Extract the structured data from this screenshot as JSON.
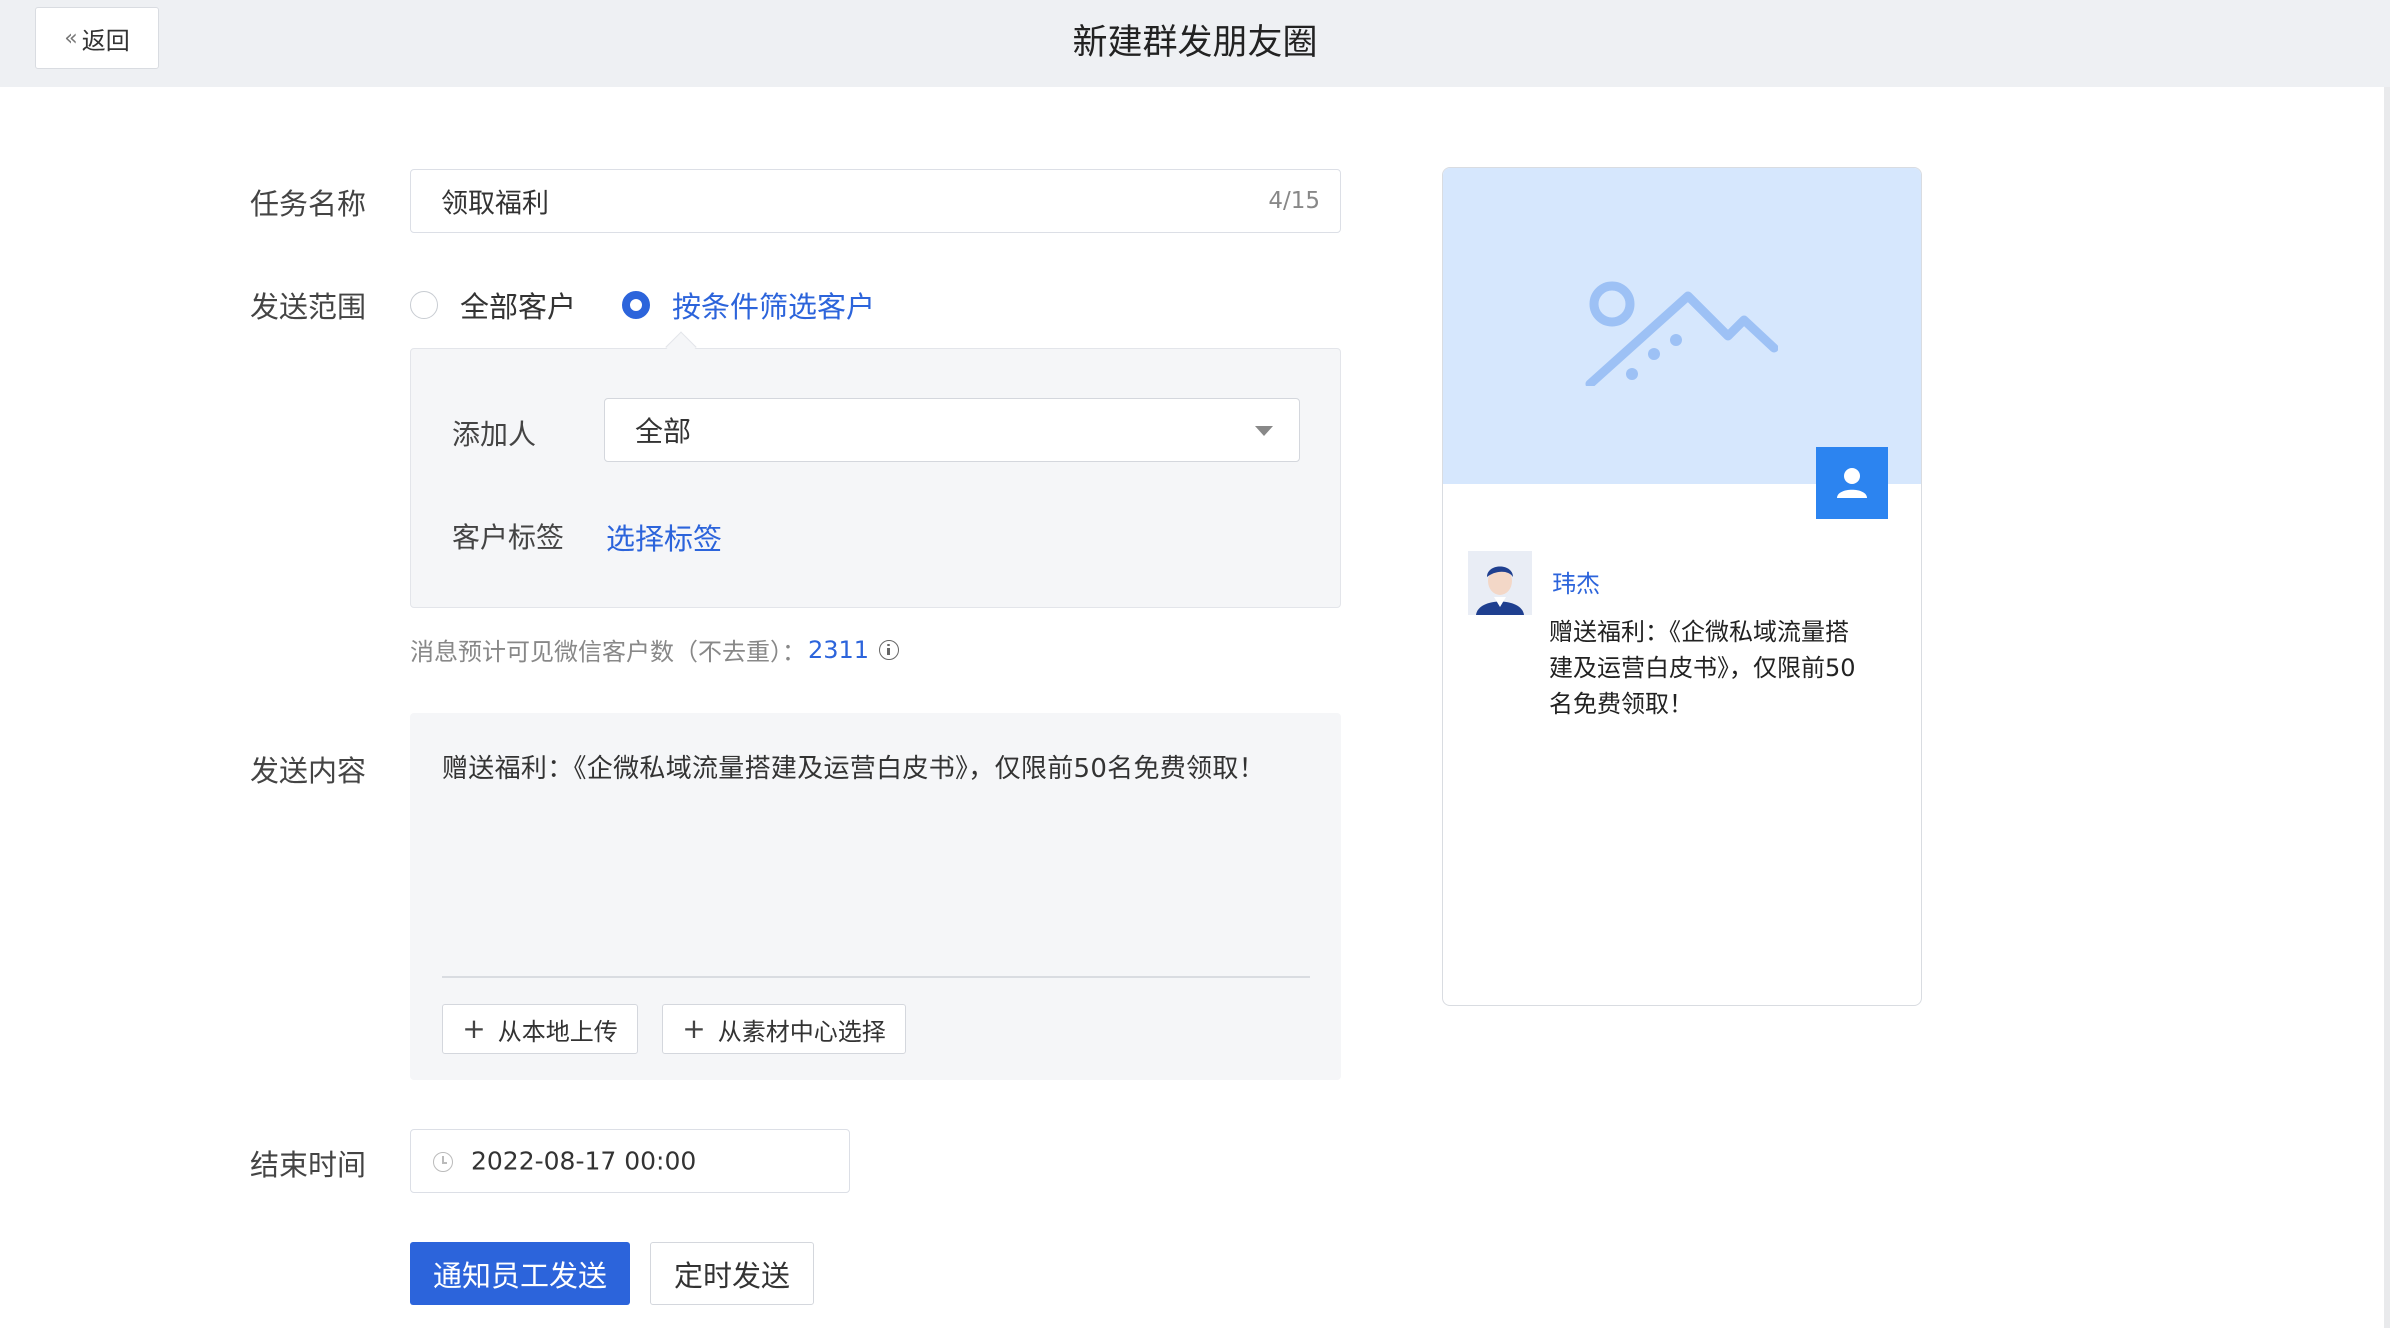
{
  "header": {
    "back_label": "返回",
    "title": "新建群发朋友圈"
  },
  "form": {
    "task_name": {
      "label": "任务名称",
      "value": "领取福利",
      "count": "4/15"
    },
    "send_scope": {
      "label": "发送范围",
      "options": [
        {
          "label": "全部客户",
          "checked": false
        },
        {
          "label": "按条件筛选客户",
          "checked": true
        }
      ],
      "filter": {
        "adder_label": "添加人",
        "adder_value": "全部",
        "tag_label": "客户标签",
        "tag_link": "选择标签"
      },
      "estimate_text": "消息预计可见微信客户数（不去重）：",
      "estimate_count": "2311"
    },
    "content": {
      "label": "发送内容",
      "text": "赠送福利：《企微私域流量搭建及运营白皮书》，仅限前50名免费领取！",
      "upload_local": "从本地上传",
      "upload_library": "从素材中心选择"
    },
    "end_time": {
      "label": "结束时间",
      "value": "2022-08-17 00:00"
    },
    "actions": {
      "notify": "通知员工发送",
      "schedule": "定时发送"
    }
  },
  "preview": {
    "user_name": "玮杰",
    "text": "赠送福利：《企微私域流量搭建及运营白皮书》，仅限前50名免费领取！"
  },
  "colors": {
    "primary": "#2c64db",
    "cover": "#d6e7fd",
    "avatar_square": "#2c84f0"
  }
}
